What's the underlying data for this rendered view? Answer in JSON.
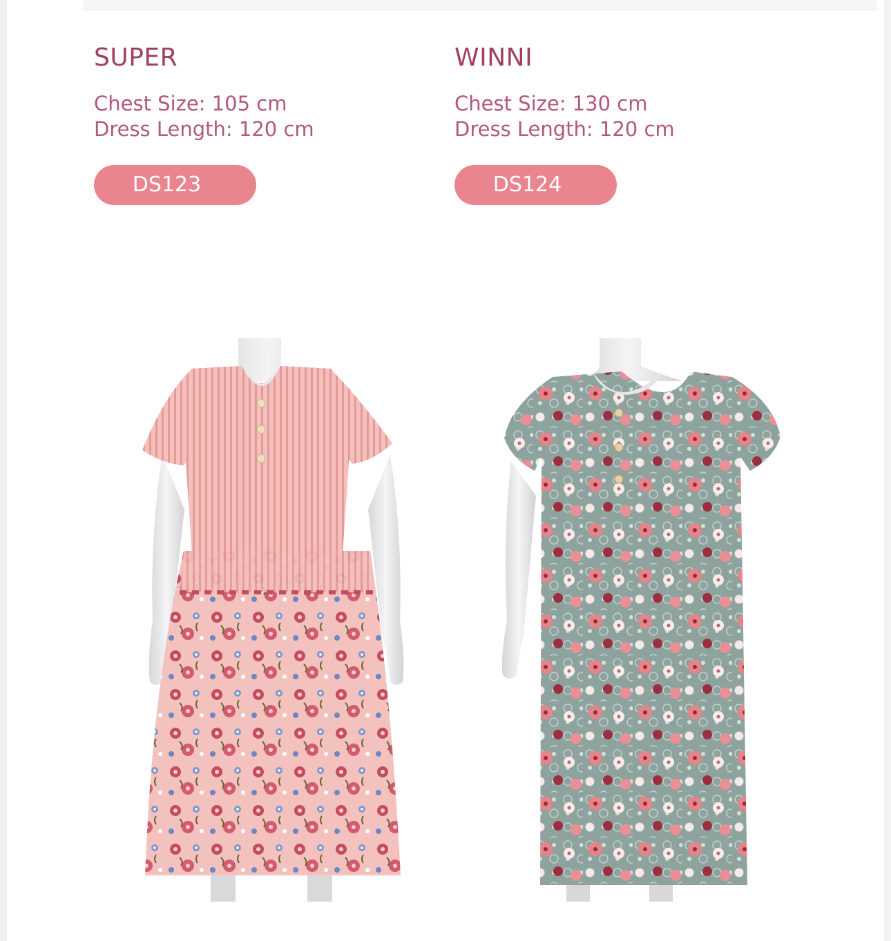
{
  "products": [
    {
      "name": "SUPER",
      "chest": "Chest Size: 105 cm",
      "length": "Dress Length: 120 cm",
      "code": "DS123",
      "image_alt": "pink striped bodice dress with floral skirt on mannequin"
    },
    {
      "name": "WINNI",
      "chest": "Chest Size: 130 cm",
      "length": "Dress Length: 120 cm",
      "code": "DS124",
      "image_alt": "grey-green floral print dress on mannequin"
    }
  ],
  "colors": {
    "title": "#a2405f",
    "spec_text": "#b2587a",
    "button_bg": "#e9858e",
    "button_text": "#ffffff"
  }
}
